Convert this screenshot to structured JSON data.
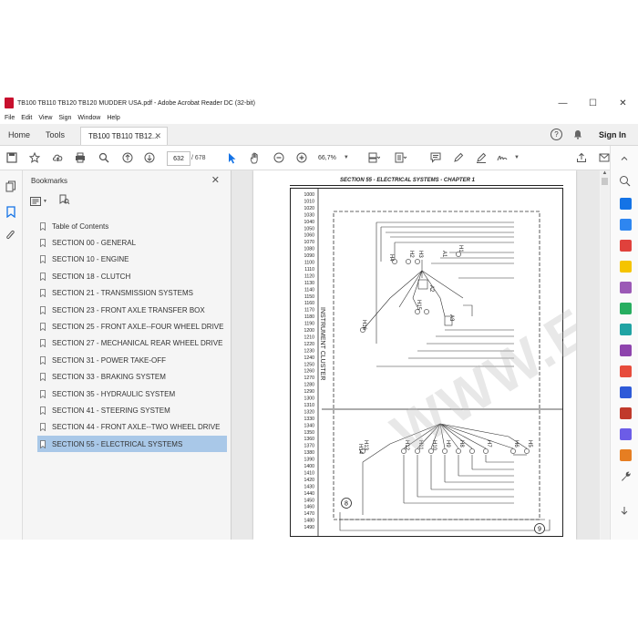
{
  "window": {
    "title": "TB100 TB110 TB120 TB120 MUDDER USA.pdf - Adobe Acrobat Reader DC (32-bit)",
    "controls": {
      "minimize": "—",
      "maximize": "☐",
      "close": "✕"
    }
  },
  "menu": [
    "File",
    "Edit",
    "View",
    "Sign",
    "Window",
    "Help"
  ],
  "tabs": {
    "home": "Home",
    "tools": "Tools",
    "document": "TB100 TB110 TB12...",
    "close_glyph": "✕"
  },
  "account": {
    "help_glyph": "?",
    "sign_in": "Sign In"
  },
  "toolbar": {
    "current_page": "632",
    "page_total": "/ 678",
    "zoom": "66,7%"
  },
  "bookmarks": {
    "title": "Bookmarks",
    "close_glyph": "✕",
    "items": [
      "Table of Contents",
      "SECTION 00 - GENERAL",
      "SECTION 10 - ENGINE",
      "SECTION 18 - CLUTCH",
      "SECTION 21 - TRANSMISSION SYSTEMS",
      "SECTION 23 - FRONT AXLE TRANSFER BOX",
      "SECTION 25 - FRONT AXLE--FOUR WHEEL DRIVE",
      "SECTION 27 - MECHANICAL REAR WHEEL DRIVE",
      "SECTION 31 - POWER TAKE-OFF",
      "SECTION 33 - BRAKING SYSTEM",
      "SECTION 35 - HYDRAULIC SYSTEM",
      "SECTION 41 - STEERING SYSTEM",
      "SECTION 44 - FRONT AXLE--TWO WHEEL DRIVE",
      "SECTION 55 - ELECTRICAL SYSTEMS"
    ],
    "selected_index": 13
  },
  "document": {
    "header": "SECTION 55 - ELECTRICAL SYSTEMS - CHAPTER 1",
    "row_numbers": [
      "1000",
      "1010",
      "1020",
      "1030",
      "1040",
      "1050",
      "1060",
      "1070",
      "1080",
      "1090",
      "1100",
      "1110",
      "1120",
      "1130",
      "1140",
      "1150",
      "1160",
      "1170",
      "1180",
      "1190",
      "1200",
      "1210",
      "1220",
      "1230",
      "1240",
      "1250",
      "1260",
      "1270",
      "1280",
      "1290",
      "1300",
      "1310",
      "1320",
      "1330",
      "1340",
      "1350",
      "1360",
      "1370",
      "1380",
      "1390",
      "1400",
      "1410",
      "1420",
      "1430",
      "1440",
      "1450",
      "1460",
      "1470",
      "1480",
      "1490"
    ],
    "vertical_label": "INSTRUMENT CLUSTER",
    "components_upper": [
      "H1",
      "A1",
      "H2",
      "H3",
      "H4",
      "A2",
      "H15",
      "H16",
      "A3"
    ],
    "components_lower": [
      "H13",
      "H14",
      "H12",
      "H11",
      "H10",
      "H9",
      "H8",
      "H7",
      "H6",
      "H5"
    ],
    "markers": [
      "8",
      "9"
    ],
    "watermark": "WWW.EPCDEPOT.COM"
  },
  "colors": {
    "accent_red": "#c8102e",
    "selected_bookmark": "#a9c8e8",
    "tool_blue": "#1473e6"
  }
}
